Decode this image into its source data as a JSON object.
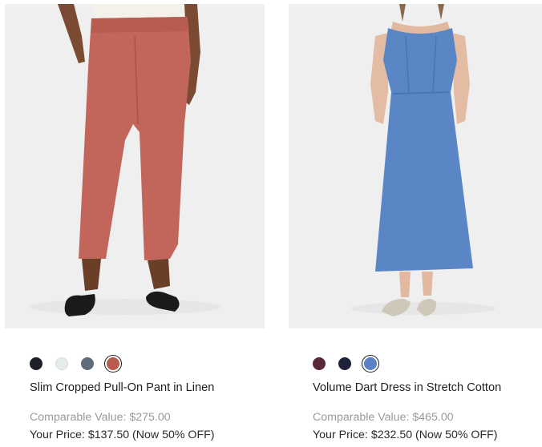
{
  "products": [
    {
      "name": "Slim Cropped Pull-On Pant in Linen",
      "comparable_value": "Comparable Value: $275.00",
      "your_price": "Your Price: $137.50 (Now 50% OFF)",
      "image_icon": "pants-product-photo",
      "swatches": [
        {
          "color": "#1e2027",
          "selected": false
        },
        {
          "color": "#e6ecea",
          "selected": false
        },
        {
          "color": "#5f6d7a",
          "selected": false
        },
        {
          "color": "#b85c4e",
          "selected": true
        }
      ]
    },
    {
      "name": "Volume Dart Dress in Stretch Cotton",
      "comparable_value": "Comparable Value: $465.00",
      "your_price": "Your Price: $232.50 (Now 50% OFF)",
      "image_icon": "dress-product-photo",
      "swatches": [
        {
          "color": "#5a2838",
          "selected": false
        },
        {
          "color": "#1f2238",
          "selected": false
        },
        {
          "color": "#5b82c4",
          "selected": true
        }
      ]
    }
  ]
}
